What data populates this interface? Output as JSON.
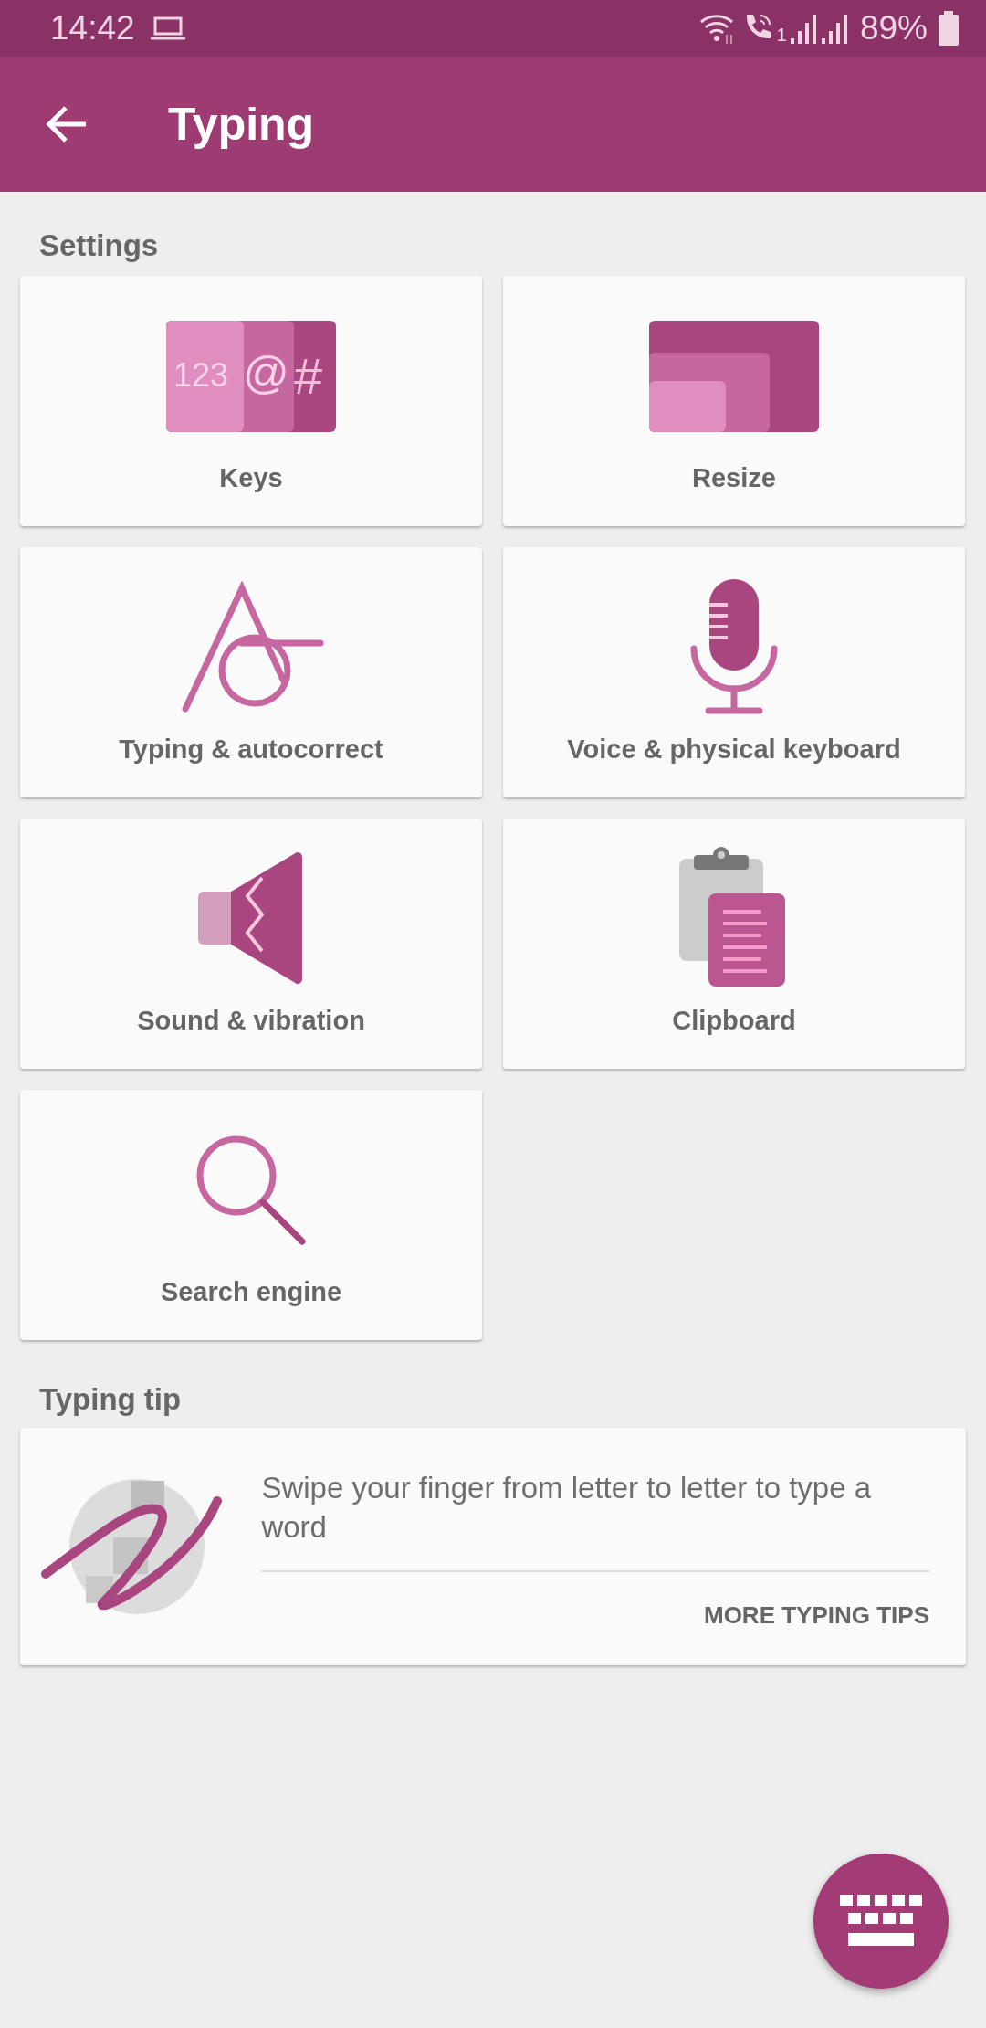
{
  "status_bar": {
    "time": "14:42",
    "sim_label": "1",
    "battery": "89%"
  },
  "app_bar": {
    "title": "Typing"
  },
  "settings": {
    "heading": "Settings",
    "tiles": [
      {
        "kind": "keys",
        "label": "Keys",
        "icon_texts": [
          "123",
          "@",
          "#"
        ]
      },
      {
        "kind": "resize",
        "label": "Resize"
      },
      {
        "kind": "autocorrect",
        "label": "Typing & autocorrect"
      },
      {
        "kind": "voice",
        "label": "Voice & physical keyboard"
      },
      {
        "kind": "sound",
        "label": "Sound & vibration"
      },
      {
        "kind": "clipboard",
        "label": "Clipboard"
      },
      {
        "kind": "search",
        "label": "Search engine"
      }
    ]
  },
  "typing_tip": {
    "heading": "Typing tip",
    "text": "Swipe your finger from letter to letter to type a word",
    "link": "MORE TYPING TIPS"
  }
}
